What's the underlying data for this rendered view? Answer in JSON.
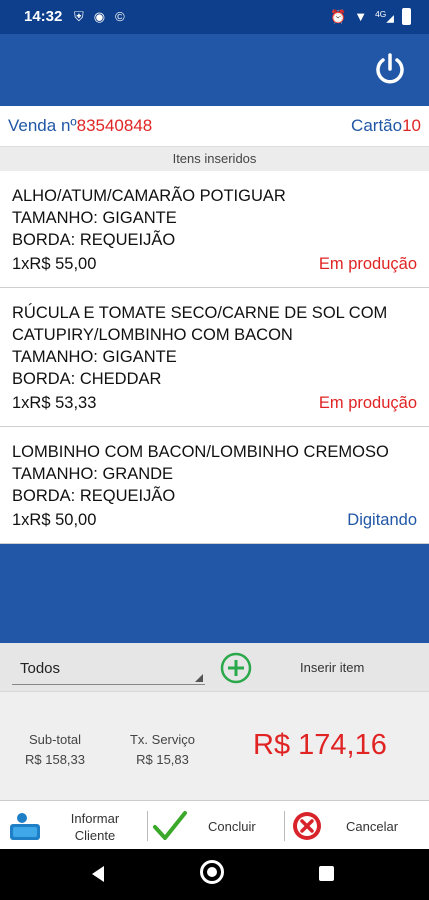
{
  "status_bar": {
    "time": "14:32",
    "left_icons": [
      "shield-icon",
      "lock-icon",
      "copyright-icon"
    ],
    "right_icons": [
      "alarm-icon",
      "wifi-icon",
      "signal-4g-icon",
      "battery-icon"
    ],
    "network": "4G"
  },
  "header": {
    "power_icon": "power-icon"
  },
  "sale": {
    "label": "Venda nº",
    "number": "83540848",
    "card_label": "Cartão",
    "card_number": "10"
  },
  "items_section": {
    "title": "Itens inseridos",
    "items": [
      {
        "lines": [
          "ALHO/ATUM/CAMARÃO POTIGUAR",
          "TAMANHO: GIGANTE",
          "BORDA: REQUEIJÃO"
        ],
        "qty_price": "1xR$ 55,00",
        "status": "Em produção",
        "status_color": "#e02424"
      },
      {
        "lines": [
          "RÚCULA E TOMATE SECO/CARNE DE SOL COM",
          "CATUPIRY/LOMBINHO COM BACON",
          "TAMANHO: GIGANTE",
          "BORDA: CHEDDAR"
        ],
        "qty_price": "1xR$ 53,33",
        "status": "Em produção",
        "status_color": "#e02424"
      },
      {
        "lines": [
          "LOMBINHO COM BACON/LOMBINHO CREMOSO",
          "TAMANHO: GRANDE",
          "BORDA: REQUEIJÃO"
        ],
        "qty_price": "1xR$ 50,00",
        "status": "Digitando",
        "status_color": "#2157a6"
      }
    ]
  },
  "controls": {
    "filter_selected": "Todos",
    "insert_label": "Inserir item"
  },
  "totals": {
    "subtotal_label": "Sub-total",
    "subtotal_value": "R$ 158,33",
    "service_label": "Tx. Serviço",
    "service_value": "R$ 15,83",
    "grand_total": "R$ 174,16"
  },
  "actions": {
    "inform_client_line1": "Informar",
    "inform_client_line2": "Cliente",
    "conclude": "Concluir",
    "cancel": "Cancelar"
  },
  "colors": {
    "brand_blue": "#2157a6",
    "status_red": "#e02424",
    "add_green": "#2aa84a"
  }
}
